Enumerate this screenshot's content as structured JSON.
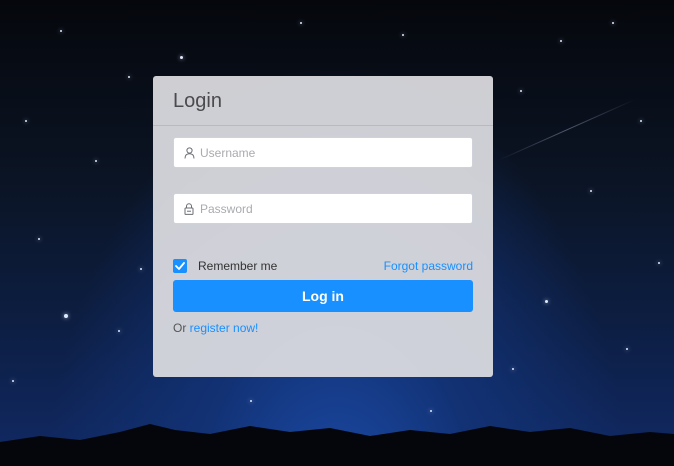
{
  "login_card": {
    "title": "Login",
    "username": {
      "placeholder": "Username",
      "value": "",
      "icon": "user-icon"
    },
    "password": {
      "placeholder": "Password",
      "value": "",
      "icon": "lock-icon"
    },
    "remember_me": {
      "label": "Remember me",
      "checked": true
    },
    "forgot_password": "Forgot password",
    "login_button": "Log in",
    "register": {
      "prefix": "Or ",
      "link": "register now!"
    }
  },
  "colors": {
    "accent": "#1890ff",
    "card_background": "#dedee2",
    "sky_dark": "#05070c",
    "sky_horizon": "#123275"
  }
}
